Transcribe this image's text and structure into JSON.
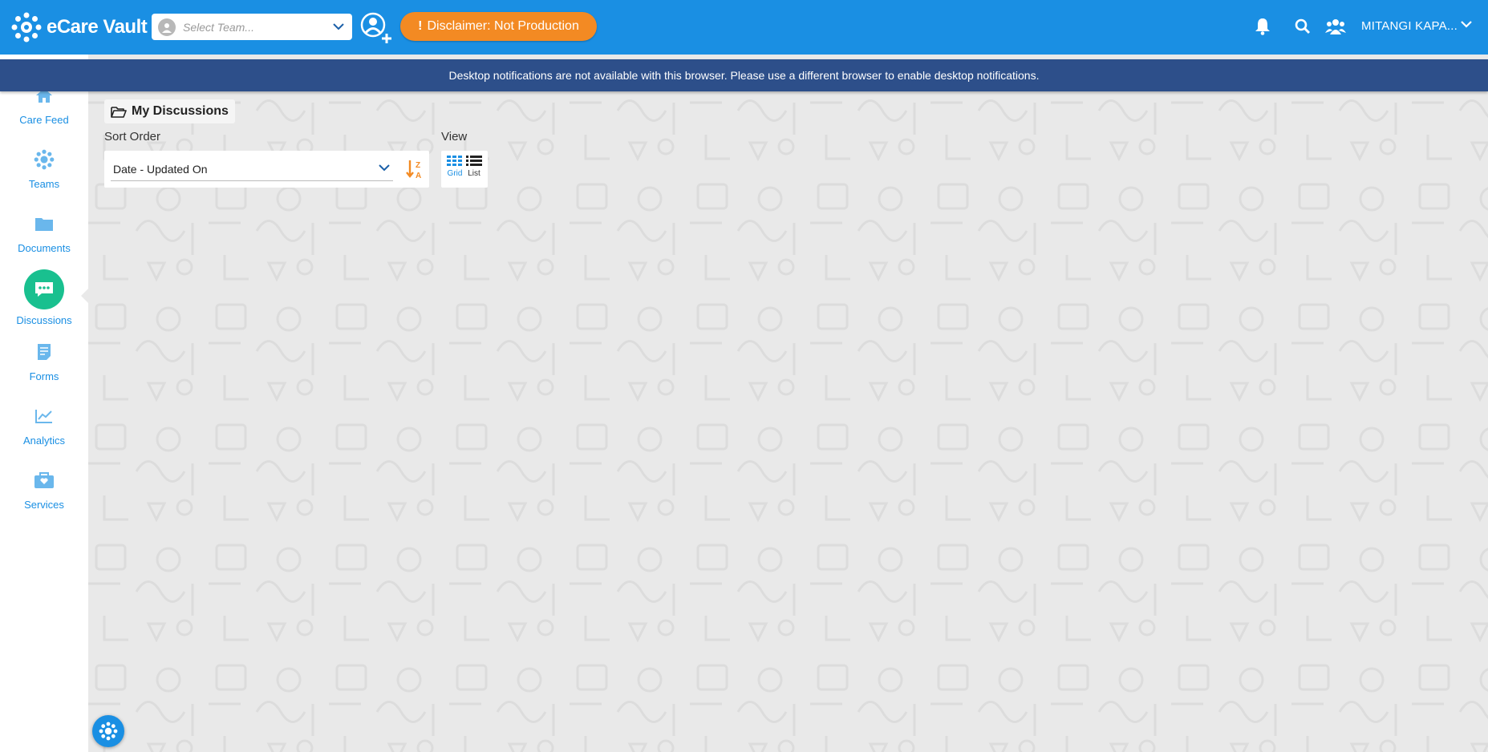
{
  "header": {
    "brand_name": "eCare Vault",
    "team_select_placeholder": "Select Team...",
    "disclaimer_text": "Disclaimer: Not Production",
    "user_name": "MITANGI KAPA...",
    "icons": [
      "bell-icon",
      "search-icon",
      "team-icon",
      "add-user-icon"
    ]
  },
  "notice": {
    "text": "Desktop notifications are not available with this browser. Please use a different browser to enable desktop notifications."
  },
  "sidebar": {
    "items": [
      {
        "label": "Care Feed",
        "icon": "home-icon"
      },
      {
        "label": "Teams",
        "icon": "teams-icon"
      },
      {
        "label": "Documents",
        "icon": "folder-icon"
      },
      {
        "label": "Discussions",
        "icon": "chat-icon",
        "active": true
      },
      {
        "label": "Forms",
        "icon": "form-icon"
      },
      {
        "label": "Analytics",
        "icon": "chart-icon"
      },
      {
        "label": "Services",
        "icon": "briefcase-icon"
      }
    ]
  },
  "main": {
    "title": "My Discussions",
    "sort_label": "Sort Order",
    "sort_value": "Date - Updated On",
    "view_label": "View",
    "view_grid_label": "Grid",
    "view_list_label": "List"
  },
  "colors": {
    "primary": "#1a8fe3",
    "accent_orange": "#f38a23",
    "active_green": "#19c08f",
    "banner": "#2d4f8a"
  }
}
